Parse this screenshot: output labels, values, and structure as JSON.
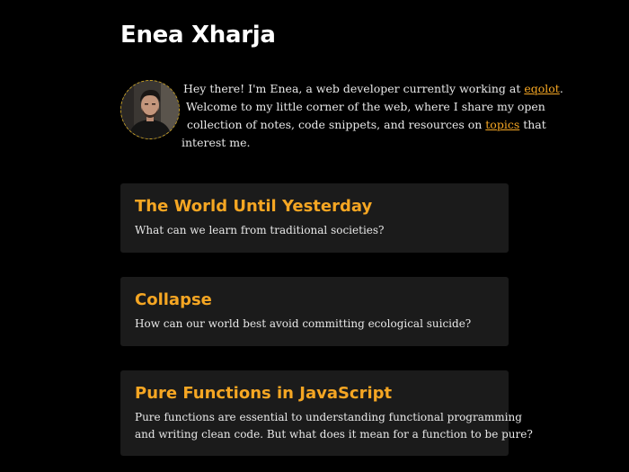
{
  "site": {
    "title": "Enea Xharja"
  },
  "intro": {
    "avatar_alt": "Enea Xharja portrait",
    "line1_text": "Hey there! I'm Enea, a web developer currently working at ",
    "company_link": "eqolot",
    "line1_end": ".",
    "line2_text": "Welcome to my little corner of the web, where I share my open",
    "line3_text": "collection of notes, code snippets, and resources on ",
    "topics_link": "topics",
    "line3_end": " that",
    "line4_text": "interest me."
  },
  "posts": [
    {
      "title": "The World Until Yesterday",
      "description": [
        "What can we learn from traditional societies?"
      ]
    },
    {
      "title": "Collapse",
      "description": [
        "How can our world best avoid committing ecological suicide?"
      ]
    },
    {
      "title": "Pure Functions in JavaScript",
      "description": [
        "Pure functions are essential to understanding functional programming",
        "and writing clean code. But what does it mean for a function to be pure?"
      ]
    }
  ],
  "colors": {
    "background": "#000000",
    "card_background": "#1b1b1b",
    "accent": "#f5a623",
    "text": "#e8e8e8",
    "heading": "#ffffff"
  }
}
